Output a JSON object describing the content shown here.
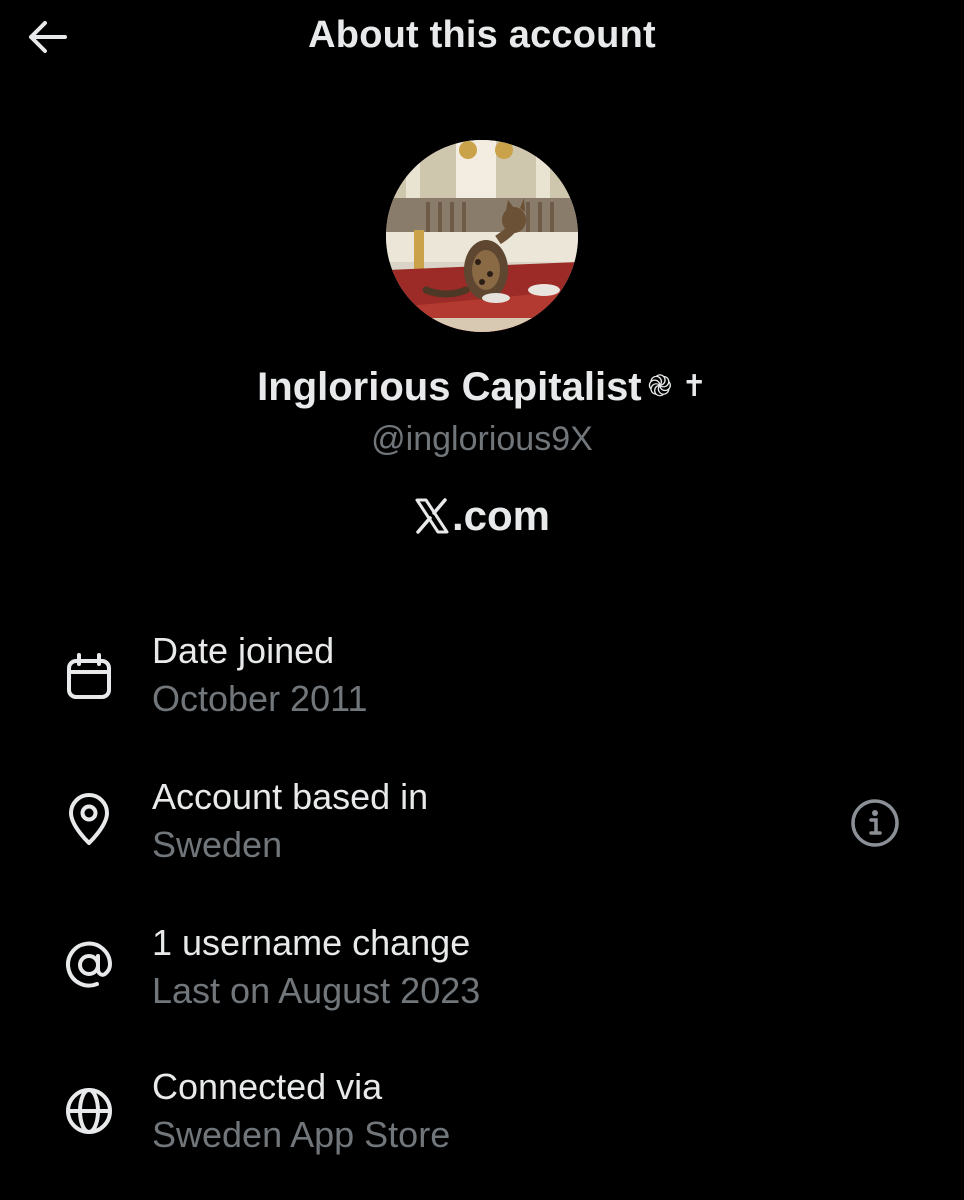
{
  "header": {
    "title": "About this account",
    "back_icon": "arrow-left-icon"
  },
  "profile": {
    "name": "Inglorious Capitalist",
    "name_emojis": "֎ ✝",
    "handle": "@inglorious9X",
    "site": ".com",
    "site_logo": "x-logo-icon"
  },
  "rows": [
    {
      "icon": "calendar-icon",
      "title": "Date joined",
      "value": "October 2011"
    },
    {
      "icon": "location-pin-icon",
      "title": "Account based in",
      "value": "Sweden",
      "trailing_icon": "info-icon"
    },
    {
      "icon": "at-sign-icon",
      "title": "1 username change",
      "value": "Last on August 2023"
    },
    {
      "icon": "globe-icon",
      "title": "Connected via",
      "value": "Sweden App Store"
    }
  ],
  "colors": {
    "background": "#000000",
    "primary_text": "#e7e9ea",
    "secondary_text": "#71767b"
  }
}
